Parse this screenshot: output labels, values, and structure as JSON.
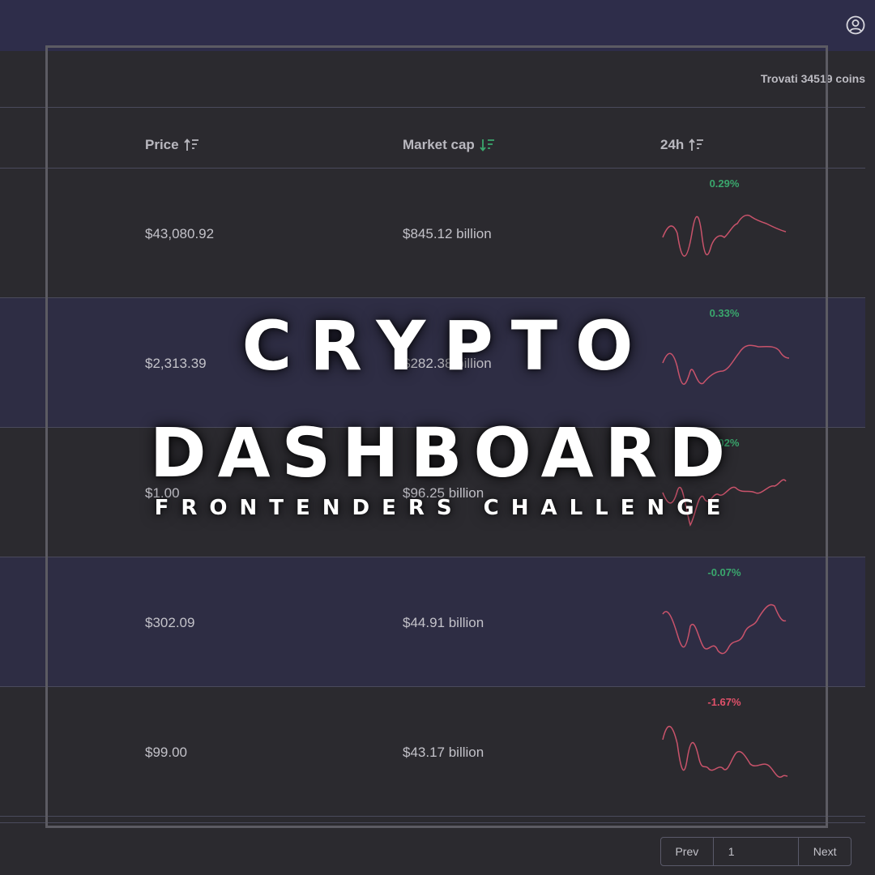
{
  "header": {
    "user_icon": "user-circle-icon"
  },
  "results": {
    "text": "Trovati 34519 coins"
  },
  "table": {
    "columns": [
      {
        "label": "Price",
        "sort_icon": "sort-ascending-icon",
        "sort_color": "#b9b8bf"
      },
      {
        "label": "Market cap",
        "sort_icon": "sort-descending-icon",
        "sort_color": "#3aa76d"
      },
      {
        "label": "24h",
        "sort_icon": "sort-ascending-icon",
        "sort_color": "#b9b8bf"
      }
    ],
    "rows": [
      {
        "price": "$43,080.92",
        "market_cap": "$845.12 billion",
        "change": "0.29%",
        "change_color": "#3aa76d"
      },
      {
        "price": "$2,313.39",
        "market_cap": "$282.38 billion",
        "change": "0.33%",
        "change_color": "#3aa76d"
      },
      {
        "price": "$1.00",
        "market_cap": "$96.25 billion",
        "change": "0.02%",
        "change_color": "#3aa76d"
      },
      {
        "price": "$302.09",
        "market_cap": "$44.91 billion",
        "change": "-0.07%",
        "change_color": "#3aa76d"
      },
      {
        "price": "$99.00",
        "market_cap": "$43.17 billion",
        "change": "-1.67%",
        "change_color": "#e0516a"
      }
    ]
  },
  "overlay": {
    "title_line1": "CRYPTO",
    "title_line2": "DASHBOARD",
    "subtitle": "FRONTENDERS CHALLENGE"
  },
  "pagination": {
    "prev_label": "Prev",
    "page_value": "1",
    "next_label": "Next"
  },
  "colors": {
    "sparkline": "#c9536b",
    "positive": "#3aa76d",
    "negative": "#e0516a"
  }
}
